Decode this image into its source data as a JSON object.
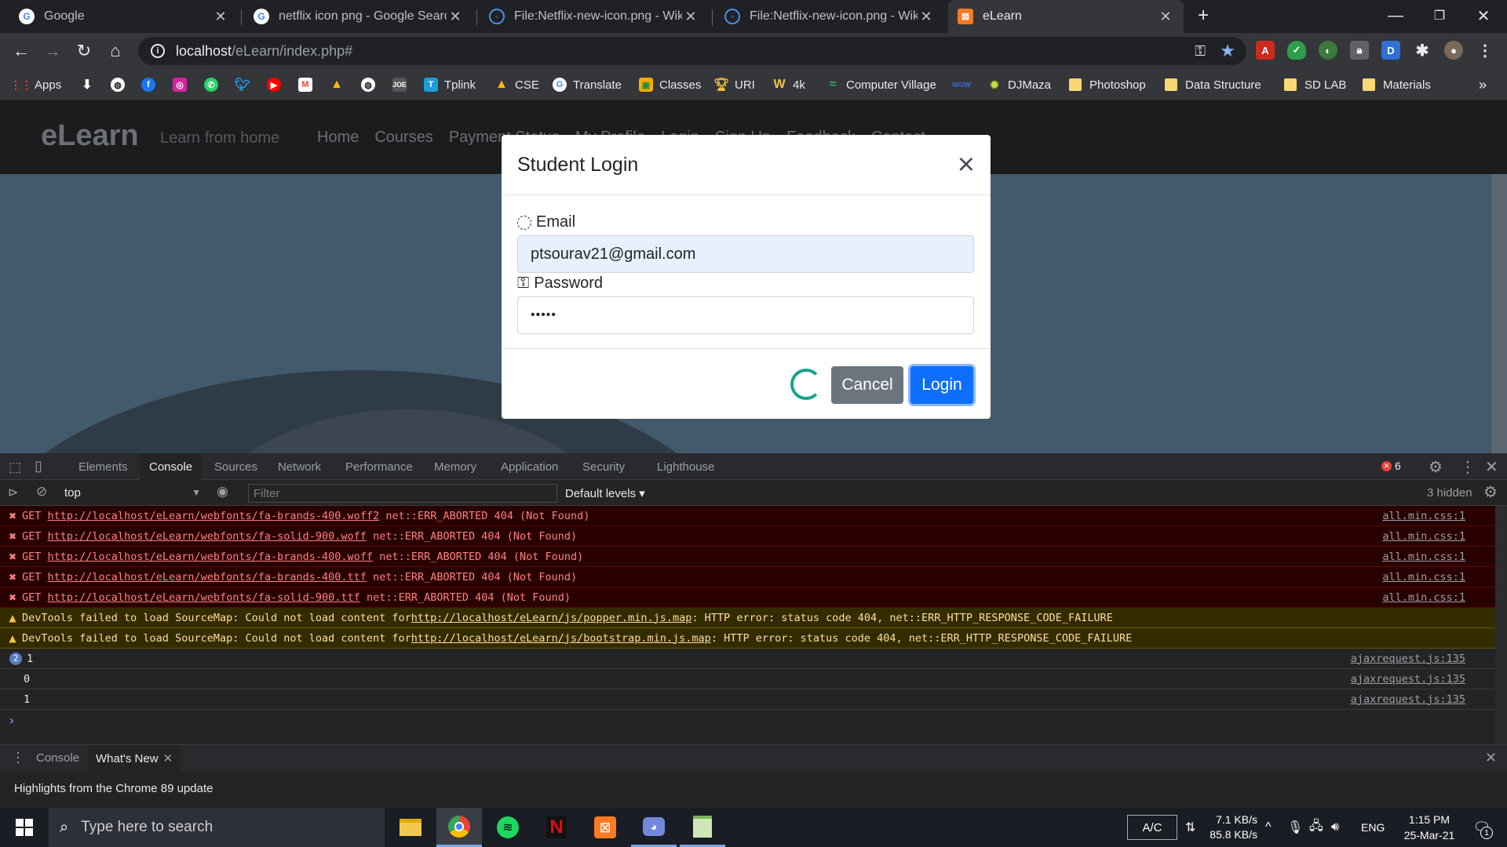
{
  "browser": {
    "tabs": [
      {
        "title": "Google",
        "icon": "google-icon"
      },
      {
        "title": "netflix icon png - Google Search",
        "icon": "google-icon"
      },
      {
        "title": "File:Netflix-new-icon.png - Wikim",
        "icon": "wikimedia-icon"
      },
      {
        "title": "File:Netflix-new-icon.png - Wikim",
        "icon": "wikimedia-icon"
      },
      {
        "title": "eLearn",
        "icon": "xampp-icon"
      }
    ],
    "url_host": "localhost",
    "url_path": "/eLearn/index.php#",
    "bookmarks": [
      {
        "label": "Apps"
      },
      {
        "label": ""
      },
      {
        "label": ""
      },
      {
        "label": ""
      },
      {
        "label": ""
      },
      {
        "label": ""
      },
      {
        "label": ""
      },
      {
        "label": ""
      },
      {
        "label": ""
      },
      {
        "label": ""
      },
      {
        "label": ""
      },
      {
        "label": ""
      },
      {
        "label": "Tplink"
      },
      {
        "label": "CSE"
      },
      {
        "label": "Translate"
      },
      {
        "label": "Classes"
      },
      {
        "label": "URI"
      },
      {
        "label": "4k"
      },
      {
        "label": "Computer Village"
      },
      {
        "label": ""
      },
      {
        "label": "DJMaza"
      },
      {
        "label": "Photoshop"
      },
      {
        "label": "Data Structure"
      },
      {
        "label": "SD LAB"
      },
      {
        "label": "Materials"
      }
    ],
    "more_bookmarks": "»"
  },
  "site": {
    "brand": "eLearn",
    "tagline": "Learn from home",
    "nav": [
      "Home",
      "Courses",
      "Payment Status",
      "My Profile",
      "Login",
      "Sign Up",
      "Feedback",
      "Contact"
    ]
  },
  "modal": {
    "title": "Student Login",
    "close": "×",
    "email_label": "Email",
    "email_value": "ptsourav21@gmail.com",
    "password_label": "Password",
    "password_value": "•••••",
    "cancel": "Cancel",
    "login": "Login"
  },
  "devtools": {
    "tabs": [
      "Elements",
      "Console",
      "Sources",
      "Network",
      "Performance",
      "Memory",
      "Application",
      "Security",
      "Lighthouse"
    ],
    "active_tab": "Console",
    "error_count": "6",
    "context": "top",
    "filter_placeholder": "Filter",
    "levels": "Default levels ▾",
    "hidden": "3 hidden",
    "errors": [
      {
        "method": "GET",
        "url": "http://localhost/eLearn/webfonts/fa-brands-400.woff2",
        "msg": "net::ERR_ABORTED 404 (Not Found)",
        "src": "all.min.css:1"
      },
      {
        "method": "GET",
        "url": "http://localhost/eLearn/webfonts/fa-solid-900.woff",
        "msg": "net::ERR_ABORTED 404 (Not Found)",
        "src": "all.min.css:1"
      },
      {
        "method": "GET",
        "url": "http://localhost/eLearn/webfonts/fa-brands-400.woff",
        "msg": "net::ERR_ABORTED 404 (Not Found)",
        "src": "all.min.css:1"
      },
      {
        "method": "GET",
        "url": "http://localhost/eLearn/webfonts/fa-brands-400.ttf",
        "msg": "net::ERR_ABORTED 404 (Not Found)",
        "src": "all.min.css:1"
      },
      {
        "method": "GET",
        "url": "http://localhost/eLearn/webfonts/fa-solid-900.ttf",
        "msg": "net::ERR_ABORTED 404 (Not Found)",
        "src": "all.min.css:1"
      }
    ],
    "warnings": [
      {
        "prefix": "DevTools failed to load SourceMap: Could not load content for ",
        "url": "http://localhost/eLearn/js/popper.min.js.map",
        "suffix": ": HTTP error: status code 404, net::ERR_HTTP_RESPONSE_CODE_FAILURE"
      },
      {
        "prefix": "DevTools failed to load SourceMap: Could not load content for ",
        "url": "http://localhost/eLearn/js/bootstrap.min.js.map",
        "suffix": ": HTTP error: status code 404, net::ERR_HTTP_RESPONSE_CODE_FAILURE"
      }
    ],
    "logs": [
      {
        "badge": "2",
        "value": "1",
        "src": "ajaxrequest.js:135"
      },
      {
        "badge": "",
        "value": "0",
        "src": "ajaxrequest.js:135"
      },
      {
        "badge": "",
        "value": "1",
        "src": "ajaxrequest.js:135"
      }
    ],
    "prompt": "›",
    "drawer_tabs": [
      "Console",
      "What's New"
    ],
    "whatsnew_text": "Highlights from the Chrome 89 update"
  },
  "taskbar": {
    "search_placeholder": "Type here to search",
    "ac": "A/C",
    "net_down": "7.1 KB/s",
    "net_up": "85.8 KB/s",
    "lang": "ENG",
    "time": "1:15 PM",
    "date": "25-Mar-21",
    "notif": "1"
  }
}
